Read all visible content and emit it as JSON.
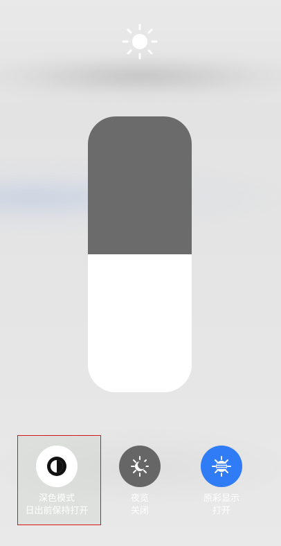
{
  "brightness": {
    "level_fraction": 0.5
  },
  "controls": {
    "dark_mode": {
      "line1": "深色模式",
      "line2": "日出前保持打开",
      "icon": "dark-mode-icon"
    },
    "night_shift": {
      "line1": "夜览",
      "line2": "关闭",
      "icon": "night-shift-icon"
    },
    "true_tone": {
      "line1": "原彩显示",
      "line2": "打开",
      "icon": "true-tone-icon"
    }
  },
  "colors": {
    "accent_blue": "#2f7cf6",
    "slider_dark": "#6b6b6b",
    "slider_fill": "#ffffff",
    "highlight_border": "#d01818"
  }
}
